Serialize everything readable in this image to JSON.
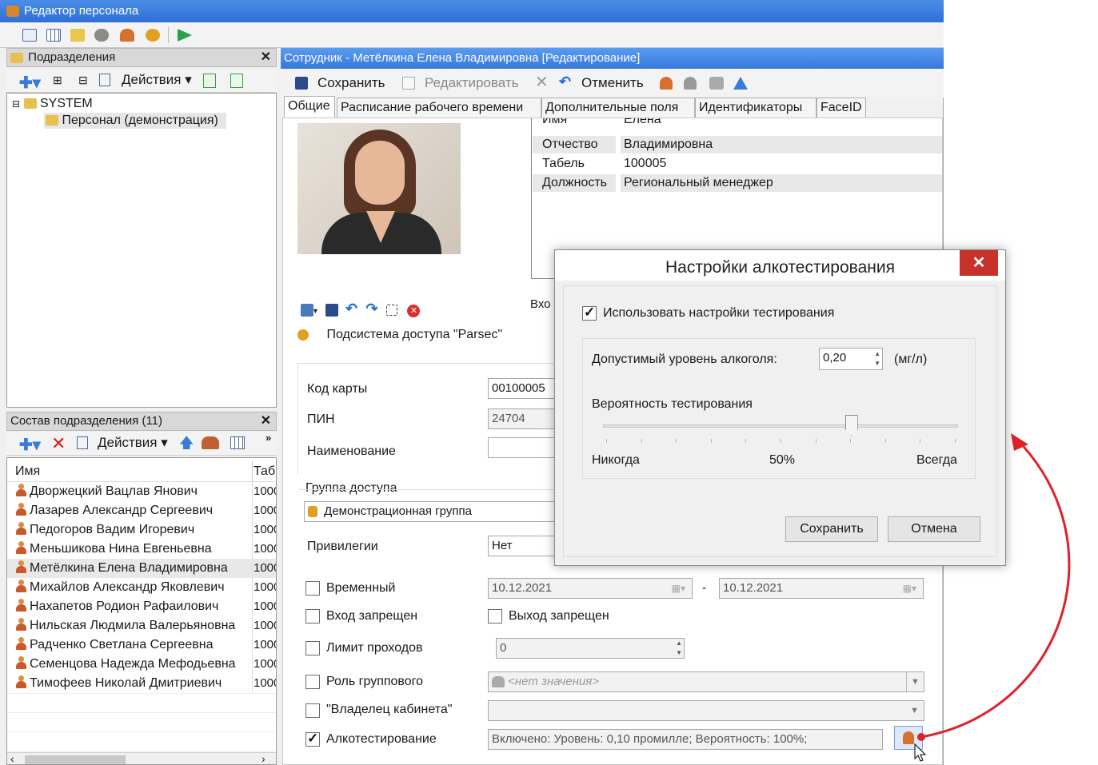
{
  "app": {
    "title": "Редактор персонала"
  },
  "departments": {
    "header": "Подразделения",
    "actions_label": "Действия",
    "tree": [
      {
        "label": "SYSTEM"
      },
      {
        "label": "Персонал (демонстрация)"
      }
    ]
  },
  "staff": {
    "header": "Состав подразделения (11)",
    "actions_label": "Действия",
    "col_name": "Имя",
    "col_tab": "Таб",
    "rows": [
      {
        "name": "Дворжецкий Вацлав Янович",
        "tab": "1000"
      },
      {
        "name": "Лазарев Александр Сергеевич",
        "tab": "1000"
      },
      {
        "name": "Педогоров Вадим Игоревич",
        "tab": "1000"
      },
      {
        "name": "Меньшикова Нина Евгеньевна",
        "tab": "1000"
      },
      {
        "name": "Метёлкина Елена Владимировна",
        "tab": "1000"
      },
      {
        "name": "Михайлов Александр Яковлевич",
        "tab": "1000"
      },
      {
        "name": "Нахапетов Родион Рафаилович",
        "tab": "1000"
      },
      {
        "name": "Нильская Людмила Валерьяновна",
        "tab": "1000"
      },
      {
        "name": "Радченко Светлана Сергеевна",
        "tab": "1000"
      },
      {
        "name": "Семенцова Надежда Мефодьевна",
        "tab": "1000"
      },
      {
        "name": "Тимофеев Николай Дмитриевич",
        "tab": "1000"
      }
    ]
  },
  "employee": {
    "title": "Сотрудник - Метёлкина Елена Владимировна [Редактирование]",
    "toolbar": {
      "save": "Сохранить",
      "edit": "Редактировать",
      "cancel": "Отменить"
    },
    "tabs": [
      "Общие",
      "Расписание рабочего времени",
      "Дополнительные поля",
      "Идентификаторы",
      "FaceID"
    ],
    "fields": [
      {
        "label": "Имя",
        "value": "Елена"
      },
      {
        "label": "Отчество",
        "value": "Владимировна"
      },
      {
        "label": "Табель",
        "value": "100005"
      },
      {
        "label": "Должность",
        "value": "Региональный менеджер"
      }
    ],
    "entry_label": "Вхо",
    "subsystem": "Подсистема доступа \"Parsec\"",
    "card_code_label": "Код карты",
    "card_code": "00100005",
    "pin_label": "ПИН",
    "pin": "24704",
    "name_label": "Наименование",
    "name_value": "",
    "group_legend": "Группа доступа",
    "group_value": "Демонстрационная группа",
    "priv_label": "Привилегии",
    "priv_value": "Нет",
    "temp_label": "Временный",
    "date_from": "10.12.2021",
    "date_sep": "-",
    "date_to": "10.12.2021",
    "entry_denied": "Вход запрещен",
    "exit_denied": "Выход запрещен",
    "pass_limit": "Лимит проходов",
    "pass_limit_value": "0",
    "group_role": "Роль группового",
    "group_role_value": "<нет значения>",
    "office_owner": "\"Владелец кабинета\"",
    "alco_label": "Алкотестирование",
    "alco_value": "Включено: Уровень: 0,10 промилле; Вероятность: 100%;"
  },
  "dialog": {
    "title": "Настройки алкотестирования",
    "close": "✕",
    "use_settings": "Использовать настройки тестирования",
    "level_label": "Допустимый уровень алкоголя:",
    "level_value": "0,20",
    "level_unit": "(мг/л)",
    "prob_label": "Вероятность тестирования",
    "prob_percent": 70,
    "scale_min": "Никогда",
    "scale_mid": "50%",
    "scale_max": "Всегда",
    "save": "Сохранить",
    "cancel": "Отмена"
  },
  "colors": {
    "title_blue": "#2f6fd6",
    "annotation_red": "#e0202a"
  }
}
